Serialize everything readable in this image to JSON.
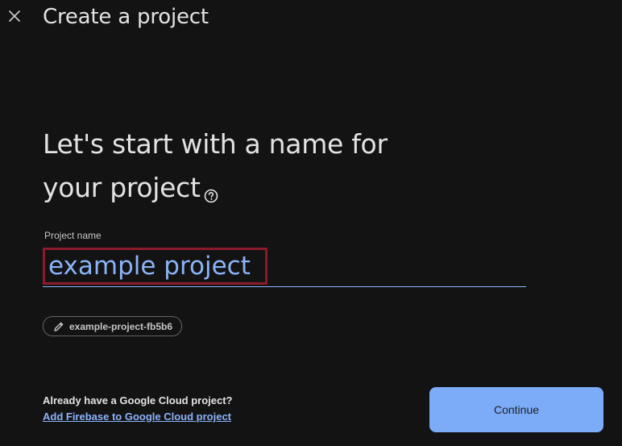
{
  "header": {
    "title": "Create a project",
    "close_icon": "close-icon"
  },
  "main": {
    "heading_line1": "Let's start with a name for",
    "heading_line2": "your project",
    "help_icon": "help-circle-icon",
    "field_label": "Project name",
    "field_value": "example project",
    "project_id_chip": "example-project-fb5b6",
    "chip_icon": "pencil-icon"
  },
  "footer": {
    "existing_question": "Already have a Google Cloud project?",
    "existing_link": "Add Firebase to Google Cloud project",
    "continue_label": "Continue"
  },
  "colors": {
    "background": "#131314",
    "accent": "#8ab4f8",
    "button": "#7cacf8",
    "focus_border": "#8b1a2a"
  }
}
